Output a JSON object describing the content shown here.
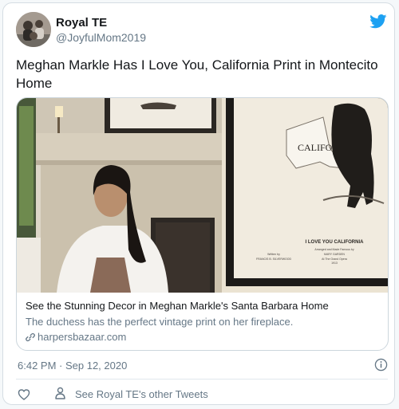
{
  "author": {
    "name": "Royal TE",
    "handle": "@JoyfulMom2019"
  },
  "tweet": {
    "text": "Meghan Markle Has I Love You, California Print in Montecito Home"
  },
  "link_card": {
    "title": "See the Stunning Decor in Meghan Markle's Santa Barbara Home",
    "description": "The duchess has the perfect vintage print on her fireplace.",
    "domain": "harpersbazaar.com",
    "image": {
      "print_map_text": "CALIFORNIA",
      "print_caption": "I LOVE YOU CALIFORNIA",
      "print_small_left": "Written by",
      "print_small_left2": "FRANCIS B. SILVERWOOD",
      "print_small_right": "Arranged and Made Famous by",
      "print_small_right2": "MARY GARDEN",
      "print_small_right3": "At The Grand Opera",
      "print_small_right4": "1913"
    }
  },
  "meta": {
    "timestamp": "6:42 PM · Sep 12, 2020"
  },
  "actions": {
    "other_tweets": "See Royal TE's other Tweets"
  },
  "colors": {
    "twitter_blue": "#1da1f2",
    "text_primary": "#14171a",
    "text_secondary": "#657786",
    "border": "#ccd6dd"
  },
  "icons": [
    "twitter-bird-icon",
    "link-icon",
    "info-icon",
    "heart-icon",
    "person-icon"
  ]
}
